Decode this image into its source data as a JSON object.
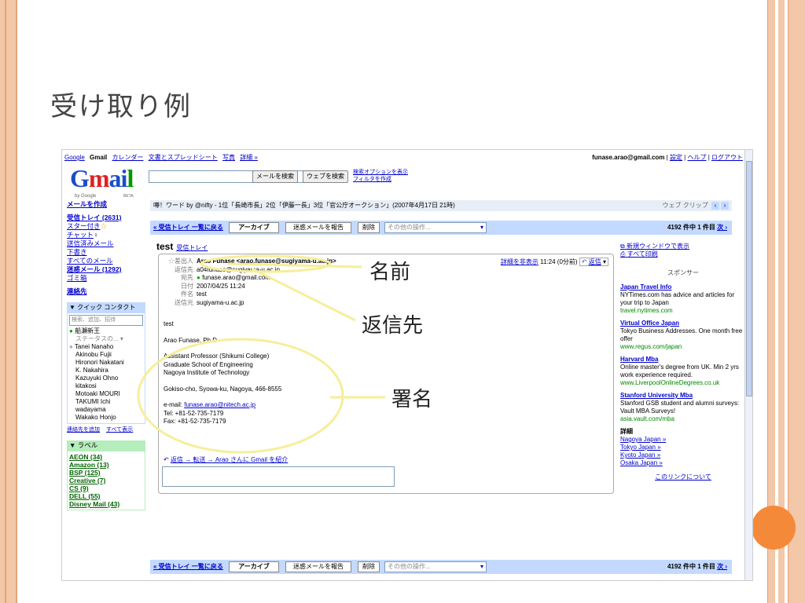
{
  "slide": {
    "title": "受け取り例"
  },
  "gmail": {
    "topnav": [
      "Google",
      "Gmail",
      "カレンダー",
      "文書とスプレッドシート",
      "写真",
      "詳細 »"
    ],
    "account": "funase.arao@gmail.com",
    "settings": "設定",
    "help": "ヘルプ",
    "logout": "ログアウト",
    "logo": "Gmail",
    "logo_by": "by Google",
    "logo_beta": "BETA",
    "search_mail": "メールを検索",
    "search_web": "ウェブを検索",
    "search_options": "検索オプションを表示",
    "filter_create": "フィルタを作成",
    "sidebar": {
      "compose": "メールを作成",
      "inbox": "受信トレイ (2631)",
      "starred": "スター付き",
      "chat": "チャット",
      "sent": "送信済みメール",
      "drafts": "下書き",
      "all": "すべてのメール",
      "spam": "迷惑メール (1292)",
      "trash": "ゴミ箱",
      "contacts": "連絡先",
      "quick_contacts": "▼ クイック コンタクト",
      "qc_placeholder": "検索、追加、招待",
      "qc_me": "船瀬新王",
      "qc_status": "ステータスの...",
      "qc_list": [
        "Tanei Nanaho",
        "Akinobu Fujii",
        "Hironori Nakatani",
        "K. Nakahira",
        "Kazuyuki Ohno",
        "kitakosi",
        "Motoaki MOURI",
        "TAKUMI Ichi",
        "wadayama",
        "Wakako Honjo"
      ],
      "add_contact": "連絡先を追加",
      "show_all": "すべて表示",
      "labels_head": "▼ ラベル",
      "labels": [
        "AEON (34)",
        "Amazon (13)",
        "BSP (125)",
        "Creative (7)",
        "CS (9)",
        "DELL (55)",
        "Disney Mail (43)"
      ]
    },
    "ticker": "噂！ワード by @nifty - 1位「長崎市長」2位「伊藤一長」3位「官公庁オークション」(2007年4月17日 21時)",
    "webclip": "ウェブ クリップ",
    "back_inbox": "« 受信トレイ 一覧に戻る",
    "archive": "アーカイブ",
    "report_spam": "迷惑メールを報告",
    "delete": "削除",
    "more_actions": "その他の操作...",
    "count": "4192 件中 1 件目",
    "next": "次 ›",
    "subject": "test",
    "inbox_tag": "受信トレイ",
    "header": {
      "from_label": "差出人",
      "from": "Arao Funase <arao.funase@sugiyama-u.ac.jp>",
      "replyto_label": "返信先",
      "replyto": "a04funase@sugiyama-u.ac.jp",
      "to_label": "宛先",
      "to": "funase.arao@gmail.com",
      "date_label": "日付",
      "date": "2007/04/25 11:24",
      "subj_label": "件名",
      "subj": "test",
      "mailedby_label": "送信元",
      "mailedby": "sugiyama-u.ac.jp"
    },
    "hide_details": "詳細を非表示",
    "time": "11:24 (0分前)",
    "reply": "返信",
    "body": {
      "line1": "test",
      "sig_name": "Arao Funase, Ph.D",
      "sig_lines": [
        "Assistant Professor (Shikumi College)",
        "Graduate School of Engineering",
        "Nagoya Institute of Technology"
      ],
      "address": "Gokiso-cho, Syowa-ku, Nagoya, 466-8555",
      "email_prefix": "e-mail: ",
      "email": "funase.arao@nitech.ac.jp",
      "tel": "Tel: +81-52-735-7179",
      "fax": "Fax: +81-52-735-7179"
    },
    "reply_links": "返信 → 転送 → Arao さんに Gmail を紹介",
    "ads": {
      "new_window": "新規ウィンドウで表示",
      "print_all": "すべて印刷",
      "sponsor": "スポンサー",
      "items": [
        {
          "title": "Japan Travel Info",
          "desc": "NYTimes.com has advice and articles for your trip to Japan",
          "url": "travel.nytimes.com"
        },
        {
          "title": "Virtual Office Japan",
          "desc": "Tokyo Business Addresses. One month free offer",
          "url": "www.regus.com/japan"
        },
        {
          "title": "Harvard Mba",
          "desc": "Online master's degree from UK. Min 2 yrs work experience required.",
          "url": "www.LiverpoolOnlineDegrees.co.uk"
        },
        {
          "title": "Stanford University Mba",
          "desc": "Stanford GSB student and alumni surveys: Vault MBA Surveys!",
          "url": "asia.vault.com/mba"
        }
      ],
      "details": "詳細",
      "links": [
        "Nagoya Japan »",
        "Tokyo Japan »",
        "Kyoto Japan »",
        "Osaka Japan »"
      ],
      "about": "このリンクについて"
    }
  },
  "annotations": {
    "name": "名前",
    "replyto": "返信先",
    "signature": "署名"
  },
  "colors": {
    "accent": "#f5893a",
    "border": "#f2c8a9",
    "link": "#0000cc"
  }
}
